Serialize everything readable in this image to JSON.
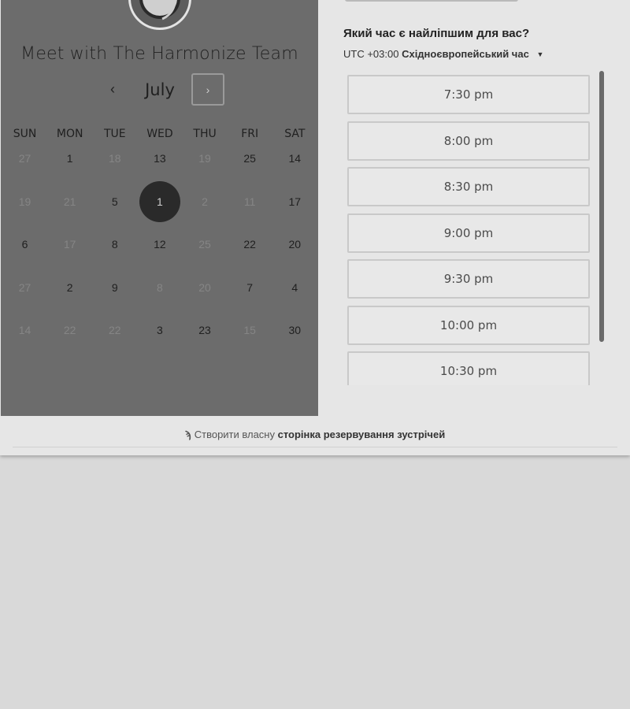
{
  "left": {
    "title": "Meet with The Harmonize Team",
    "month": "July",
    "prev_icon": "chevron-left-icon",
    "next_icon": "chevron-right-icon",
    "prev_symbol": "‹",
    "next_symbol": "›",
    "weekdays": [
      "SUN",
      "MON",
      "TUE",
      "WED",
      "THU",
      "FRI",
      "SAT"
    ],
    "weeks": [
      [
        {
          "d": "27",
          "s": "muted"
        },
        {
          "d": "1",
          "s": "avail"
        },
        {
          "d": "18",
          "s": "muted"
        },
        {
          "d": "13",
          "s": "avail"
        },
        {
          "d": "19",
          "s": "muted"
        },
        {
          "d": "25",
          "s": "avail"
        },
        {
          "d": "14",
          "s": "avail"
        }
      ],
      [
        {
          "d": "19",
          "s": "muted"
        },
        {
          "d": "21",
          "s": "muted"
        },
        {
          "d": "5",
          "s": "avail"
        },
        {
          "d": "1",
          "s": "selected"
        },
        {
          "d": "2",
          "s": "muted"
        },
        {
          "d": "11",
          "s": "muted"
        },
        {
          "d": "17",
          "s": "avail"
        }
      ],
      [
        {
          "d": "6",
          "s": "avail"
        },
        {
          "d": "17",
          "s": "muted"
        },
        {
          "d": "8",
          "s": "avail"
        },
        {
          "d": "12",
          "s": "avail"
        },
        {
          "d": "25",
          "s": "muted"
        },
        {
          "d": "22",
          "s": "avail"
        },
        {
          "d": "20",
          "s": "avail"
        }
      ],
      [
        {
          "d": "27",
          "s": "muted"
        },
        {
          "d": "2",
          "s": "avail"
        },
        {
          "d": "9",
          "s": "avail"
        },
        {
          "d": "8",
          "s": "muted"
        },
        {
          "d": "20",
          "s": "muted"
        },
        {
          "d": "7",
          "s": "avail"
        },
        {
          "d": "4",
          "s": "avail"
        }
      ],
      [
        {
          "d": "14",
          "s": "muted"
        },
        {
          "d": "22",
          "s": "muted"
        },
        {
          "d": "22",
          "s": "muted"
        },
        {
          "d": "3",
          "s": "avail"
        },
        {
          "d": "23",
          "s": "avail"
        },
        {
          "d": "15",
          "s": "muted"
        },
        {
          "d": "30",
          "s": "avail"
        }
      ]
    ]
  },
  "right": {
    "question": "Який час є найліпшим для вас?",
    "tz_offset": "UTC +03:00",
    "tz_name": "Східноєвропейський час",
    "times": [
      "7:30 pm",
      "8:00 pm",
      "8:30 pm",
      "9:00 pm",
      "9:30 pm",
      "10:00 pm",
      "10:30 pm"
    ]
  },
  "footer": {
    "prefix": "Створити власну",
    "link": "сторінка резервування зустрічей",
    "icon": "sprocket-icon",
    "icon_symbol": "ϡ"
  }
}
